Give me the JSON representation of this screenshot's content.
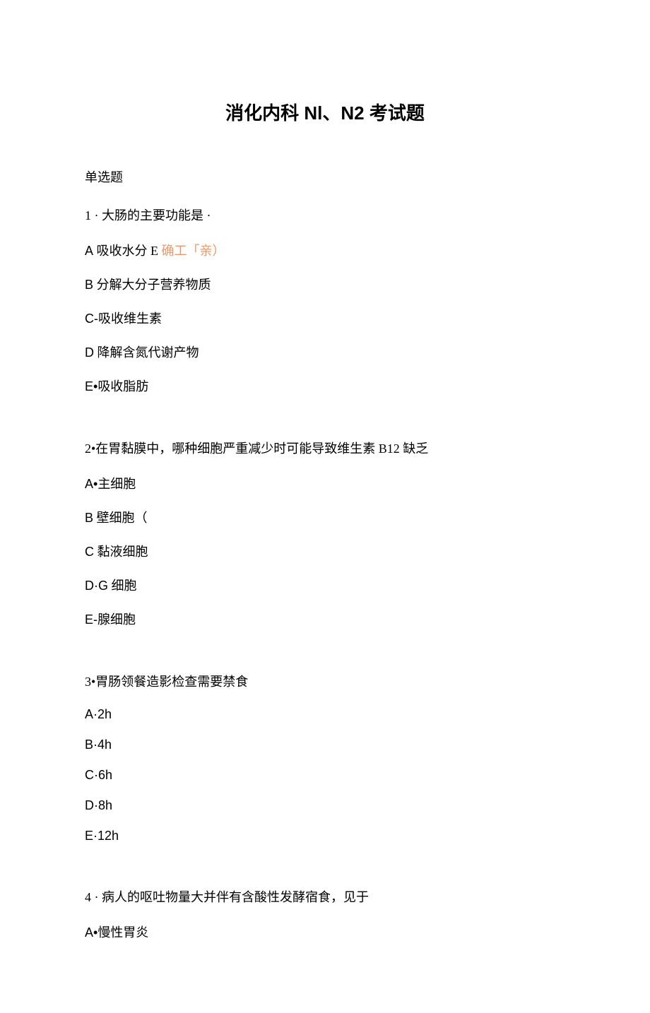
{
  "title": "消化内科 Nl、N2 考试题",
  "section_label": "单选题",
  "questions": [
    {
      "stem": "1 · 大肠的主要功能是 ·",
      "options": [
        {
          "prefix": "A",
          "text": " 吸收水分 E",
          "hint": " 确工「亲）"
        },
        {
          "prefix": "B",
          "text": " 分解大分子营养物质",
          "hint": ""
        },
        {
          "prefix": "C-",
          "text": "吸收维生素",
          "hint": ""
        },
        {
          "prefix": "D",
          "text": " 降解含氮代谢产物",
          "hint": ""
        },
        {
          "prefix": "E•",
          "text": "吸收脂肪",
          "hint": ""
        }
      ]
    },
    {
      "stem": "2•在胃黏膜中，哪种细胞严重减少时可能导致维生素 B12 缺乏",
      "options": [
        {
          "prefix": "A•",
          "text": "主细胞",
          "hint": ""
        },
        {
          "prefix": "B",
          "text": " 壁细胞（",
          "hint": ""
        },
        {
          "prefix": "C",
          "text": " 黏液细胞",
          "hint": ""
        },
        {
          "prefix": "D·G",
          "text": " 细胞",
          "hint": ""
        },
        {
          "prefix": "E-",
          "text": "腺细胞",
          "hint": ""
        }
      ]
    },
    {
      "stem": "3•胃肠领餐造影检查需要禁食",
      "options": [
        {
          "prefix": "A·2h",
          "text": "",
          "hint": ""
        },
        {
          "prefix": "B·4h",
          "text": "",
          "hint": ""
        },
        {
          "prefix": "C·6h",
          "text": "",
          "hint": ""
        },
        {
          "prefix": "D·8h",
          "text": "",
          "hint": ""
        },
        {
          "prefix": "E·12h",
          "text": "",
          "hint": ""
        }
      ]
    },
    {
      "stem": "4 · 病人的呕吐物量大并伴有含酸性发酵宿食，见于",
      "options": [
        {
          "prefix": "A•",
          "text": "慢性胃炎",
          "hint": ""
        }
      ]
    }
  ]
}
